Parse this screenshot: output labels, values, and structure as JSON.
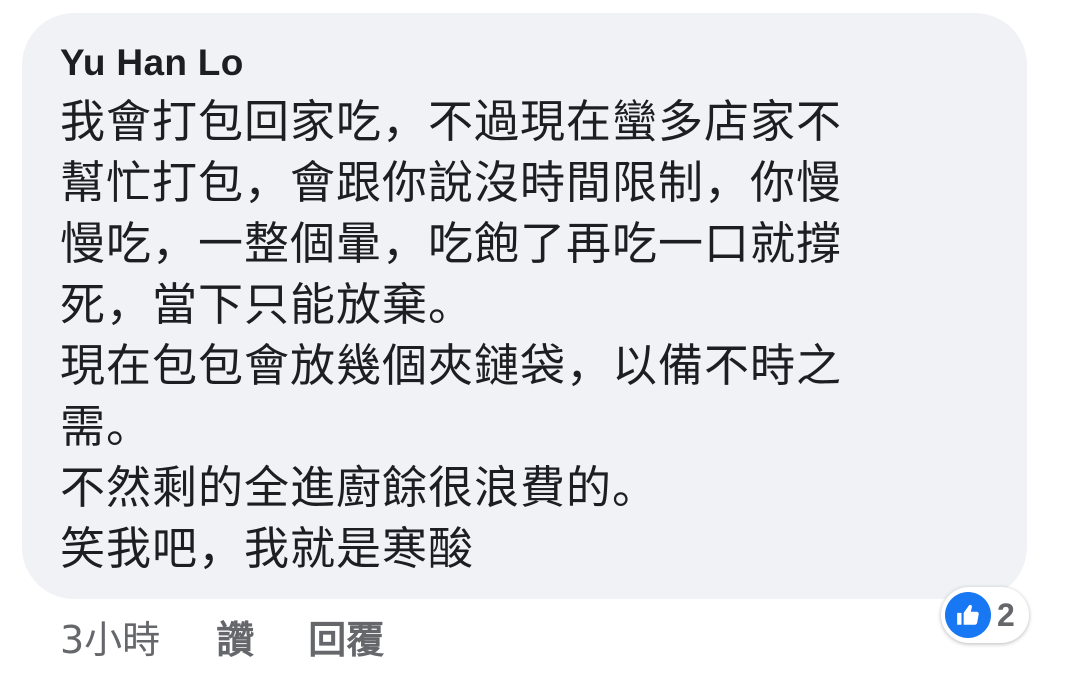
{
  "comment": {
    "author": "Yu Han Lo",
    "lines": [
      "我會打包回家吃，不過現在蠻多店家不",
      "幫忙打包，會跟你說沒時間限制，你慢",
      "慢吃，一整個暈，吃飽了再吃一口就撐",
      "死，當下只能放棄。",
      "現在包包會放幾個夾鏈袋，以備不時之",
      "需。",
      "不然剩的全進廚餘很浪費的。",
      "笑我吧，我就是寒酸"
    ]
  },
  "actions": {
    "timestamp": "3小時",
    "like_label": "讚",
    "reply_label": "回覆"
  },
  "reactions": {
    "icon": "thumbs-up-icon",
    "count": "2",
    "color": "#1877f2"
  },
  "colors": {
    "bubble_bg": "#f0f2f5",
    "text": "#1c1e21",
    "meta": "#65676b"
  }
}
